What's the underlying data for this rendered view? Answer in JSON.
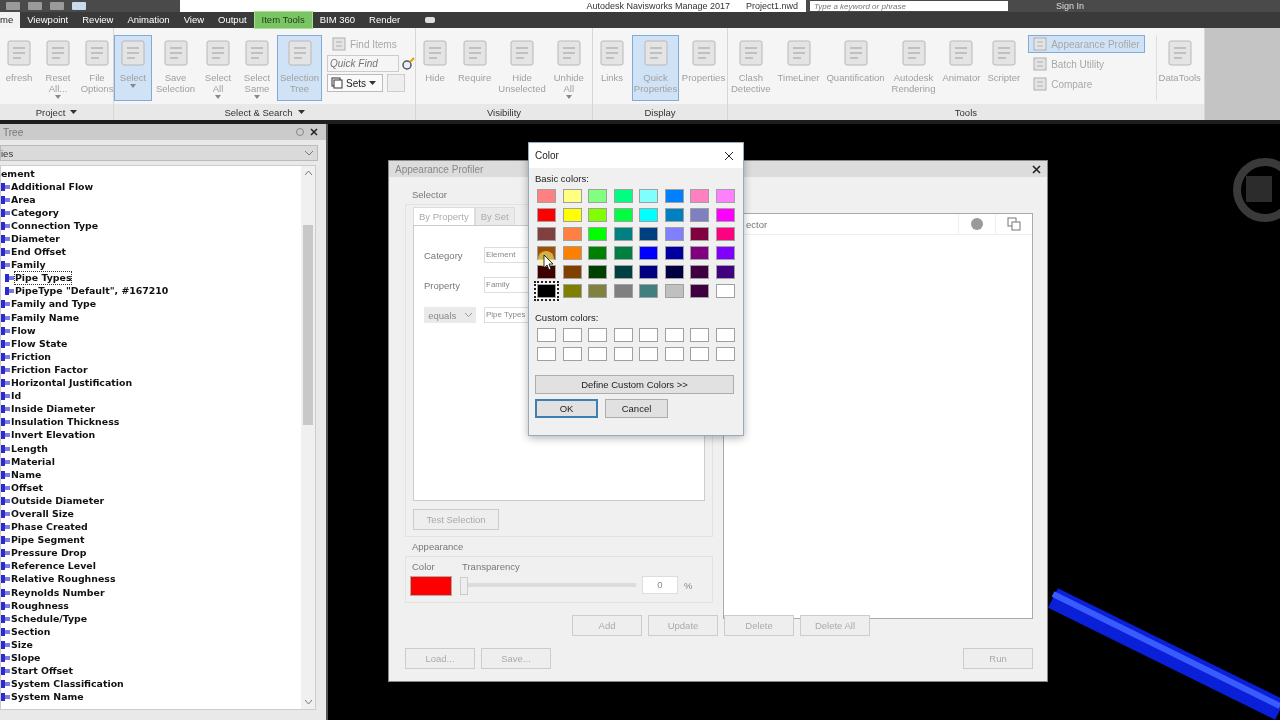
{
  "title_bar": {
    "title": "Autodesk Navisworks Manage 2017",
    "document": "Project1.nwd",
    "search": {
      "placeholder": "Type a keyword or phrase"
    },
    "sign_in": "Sign In"
  },
  "tabs": [
    {
      "label": "me",
      "selected": true,
      "kind": "normal"
    },
    {
      "label": "Viewpoint",
      "selected": false,
      "kind": "normal"
    },
    {
      "label": "Review",
      "selected": false,
      "kind": "normal"
    },
    {
      "label": "Animation",
      "selected": false,
      "kind": "normal"
    },
    {
      "label": "View",
      "selected": false,
      "kind": "normal"
    },
    {
      "label": "Output",
      "selected": false,
      "kind": "normal"
    },
    {
      "label": "Item Tools",
      "selected": false,
      "kind": "contextual"
    },
    {
      "label": "BIM 360",
      "selected": false,
      "kind": "normal"
    },
    {
      "label": "Render",
      "selected": false,
      "kind": "normal"
    }
  ],
  "ribbon": {
    "panels": [
      {
        "label": "Project",
        "menu": true,
        "items": [
          {
            "kind": "large",
            "label": "efresh",
            "active": false,
            "dropdown": false
          },
          {
            "kind": "large",
            "label": "Reset All...",
            "active": false,
            "dropdown": true
          },
          {
            "kind": "large",
            "label": "File Options",
            "active": false,
            "dropdown": false
          }
        ]
      },
      {
        "label": "Select & Search",
        "menu": true,
        "items": [
          {
            "kind": "large",
            "label": "Select",
            "active": true,
            "dropdown": true
          },
          {
            "kind": "large",
            "label": "Save Selection",
            "active": false,
            "dropdown": false
          },
          {
            "kind": "large",
            "label": "Select All",
            "active": false,
            "dropdown": true
          },
          {
            "kind": "large",
            "label": "Select Same",
            "active": false,
            "dropdown": true
          },
          {
            "kind": "large",
            "label": "Selection Tree",
            "active": true,
            "dropdown": false
          },
          {
            "kind": "stack",
            "items": [
              {
                "kind": "small",
                "label": "Find Items",
                "active": false
              },
              {
                "kind": "field",
                "placeholder": "Quick Find"
              },
              {
                "kind": "dropdown",
                "label": "Sets"
              }
            ]
          }
        ]
      },
      {
        "label": "Visibility",
        "menu": false,
        "items": [
          {
            "kind": "large",
            "label": "Hide",
            "active": false,
            "dropdown": false
          },
          {
            "kind": "large",
            "label": "Require",
            "active": false,
            "dropdown": false
          },
          {
            "kind": "large",
            "label": "Hide Unselected",
            "active": false,
            "dropdown": false
          },
          {
            "kind": "large",
            "label": "Unhide All",
            "active": false,
            "dropdown": true
          }
        ]
      },
      {
        "label": "Display",
        "menu": false,
        "items": [
          {
            "kind": "large",
            "label": "Links",
            "active": false,
            "dropdown": false
          },
          {
            "kind": "large",
            "label": "Quick Properties",
            "active": true,
            "dropdown": false
          },
          {
            "kind": "large",
            "label": "Properties",
            "active": false,
            "dropdown": false
          }
        ]
      },
      {
        "label": "Tools",
        "menu": false,
        "items": [
          {
            "kind": "large",
            "label": "Clash Detective",
            "active": false,
            "dropdown": false
          },
          {
            "kind": "large",
            "label": "TimeLiner",
            "active": false,
            "dropdown": false
          },
          {
            "kind": "large",
            "label": "Quantification",
            "active": false,
            "dropdown": false
          },
          {
            "kind": "large",
            "label": "Autodesk Rendering",
            "active": false,
            "dropdown": false
          },
          {
            "kind": "large",
            "label": "Animator",
            "active": false,
            "dropdown": false
          },
          {
            "kind": "large",
            "label": "Scripter",
            "active": false,
            "dropdown": false
          },
          {
            "kind": "stack",
            "items": [
              {
                "kind": "small",
                "label": "Appearance Profiler",
                "active": true
              },
              {
                "kind": "small",
                "label": "Batch Utility",
                "active": false
              },
              {
                "kind": "small",
                "label": "Compare",
                "active": false
              }
            ]
          },
          {
            "kind": "large",
            "label": "DataTools",
            "active": false,
            "dropdown": false
          }
        ]
      }
    ]
  },
  "tree": {
    "header": "Tree",
    "dropdown": "ies",
    "items": [
      {
        "label": "ement",
        "selected": false,
        "children": [
          {
            "label": "Additional Flow",
            "selected": false
          },
          {
            "label": "Area",
            "selected": false
          },
          {
            "label": "Category",
            "selected": false
          },
          {
            "label": "Connection Type",
            "selected": false
          },
          {
            "label": "Diameter",
            "selected": false
          },
          {
            "label": "End Offset",
            "selected": false
          },
          {
            "label": "Family",
            "selected": false,
            "children": [
              {
                "label": "Pipe Types",
                "selected": true
              },
              {
                "label": "PipeType \"Default\", #167210",
                "selected": false
              }
            ]
          },
          {
            "label": "Family and Type",
            "selected": false
          },
          {
            "label": "Family Name",
            "selected": false
          },
          {
            "label": "Flow",
            "selected": false
          },
          {
            "label": "Flow State",
            "selected": false
          },
          {
            "label": "Friction",
            "selected": false
          },
          {
            "label": "Friction Factor",
            "selected": false
          },
          {
            "label": "Horizontal Justification",
            "selected": false
          },
          {
            "label": "Id",
            "selected": false
          },
          {
            "label": "Inside Diameter",
            "selected": false
          },
          {
            "label": "Insulation Thickness",
            "selected": false
          },
          {
            "label": "Invert Elevation",
            "selected": false
          },
          {
            "label": "Length",
            "selected": false
          },
          {
            "label": "Material",
            "selected": false
          },
          {
            "label": "Name",
            "selected": false
          },
          {
            "label": "Offset",
            "selected": false
          },
          {
            "label": "Outside Diameter",
            "selected": false
          },
          {
            "label": "Overall Size",
            "selected": false
          },
          {
            "label": "Phase Created",
            "selected": false
          },
          {
            "label": "Pipe Segment",
            "selected": false
          },
          {
            "label": "Pressure Drop",
            "selected": false
          },
          {
            "label": "Reference Level",
            "selected": false
          },
          {
            "label": "Relative Roughness",
            "selected": false
          },
          {
            "label": "Reynolds Number",
            "selected": false
          },
          {
            "label": "Roughness",
            "selected": false
          },
          {
            "label": "Schedule/Type",
            "selected": false
          },
          {
            "label": "Section",
            "selected": false
          },
          {
            "label": "Size",
            "selected": false
          },
          {
            "label": "Slope",
            "selected": false
          },
          {
            "label": "Start Offset",
            "selected": false
          },
          {
            "label": "System Classification",
            "selected": false
          },
          {
            "label": "System Name",
            "selected": false
          }
        ]
      }
    ]
  },
  "appearance_profiler": {
    "title": "Appearance Profiler",
    "selector": {
      "label": "Selector",
      "tabs": [
        {
          "label": "By Property",
          "selected": true
        },
        {
          "label": "By Set",
          "selected": false
        }
      ],
      "rows": [
        {
          "label": "Category",
          "value": "Element"
        },
        {
          "label": "Property",
          "value": "Family"
        }
      ],
      "condition": "equals",
      "condition_value": "Pipe Types",
      "test_button": "Test Selection"
    },
    "appearance": {
      "label": "Appearance",
      "color_label": "Color",
      "color": "#ff0000",
      "transparency_label": "Transparency",
      "transparency": {
        "level": 0
      },
      "transparency_value": "0",
      "unit": "%"
    },
    "list": {
      "header": "ector"
    },
    "buttons": [
      "Add",
      "Update",
      "Delete",
      "Delete All"
    ],
    "file_buttons": [
      "Load...",
      "Save..."
    ],
    "run_button": "Run"
  },
  "color_dialog": {
    "title": "Color",
    "basic_label": "Basic colors:",
    "basic_colors": [
      {
        "color": "#ff8080",
        "selected": false
      },
      {
        "color": "#ffff80",
        "selected": false
      },
      {
        "color": "#80ff80",
        "selected": false
      },
      {
        "color": "#00ff80",
        "selected": false
      },
      {
        "color": "#80ffff",
        "selected": false
      },
      {
        "color": "#0080ff",
        "selected": false
      },
      {
        "color": "#ff80c0",
        "selected": false
      },
      {
        "color": "#ff80ff",
        "selected": false
      },
      {
        "color": "#ff0000",
        "selected": false
      },
      {
        "color": "#ffff00",
        "selected": false
      },
      {
        "color": "#80ff00",
        "selected": false
      },
      {
        "color": "#00ff40",
        "selected": false
      },
      {
        "color": "#00ffff",
        "selected": false
      },
      {
        "color": "#0080c0",
        "selected": false
      },
      {
        "color": "#8080c0",
        "selected": false
      },
      {
        "color": "#ff00ff",
        "selected": false
      },
      {
        "color": "#804040",
        "selected": false
      },
      {
        "color": "#ff8040",
        "selected": false
      },
      {
        "color": "#00ff00",
        "selected": false
      },
      {
        "color": "#008080",
        "selected": false
      },
      {
        "color": "#004080",
        "selected": false
      },
      {
        "color": "#8080ff",
        "selected": false
      },
      {
        "color": "#800040",
        "selected": false
      },
      {
        "color": "#ff0080",
        "selected": false
      },
      {
        "color": "#a05000",
        "selected": false
      },
      {
        "color": "#ff8000",
        "selected": false
      },
      {
        "color": "#008000",
        "selected": false
      },
      {
        "color": "#008040",
        "selected": false
      },
      {
        "color": "#0000ff",
        "selected": false
      },
      {
        "color": "#0000a0",
        "selected": false
      },
      {
        "color": "#800080",
        "selected": false
      },
      {
        "color": "#8000ff",
        "selected": false
      },
      {
        "color": "#400000",
        "selected": false
      },
      {
        "color": "#804000",
        "selected": false
      },
      {
        "color": "#004000",
        "selected": false
      },
      {
        "color": "#004040",
        "selected": false
      },
      {
        "color": "#000080",
        "selected": false
      },
      {
        "color": "#000040",
        "selected": false
      },
      {
        "color": "#400040",
        "selected": false
      },
      {
        "color": "#400080",
        "selected": false
      },
      {
        "color": "#000000",
        "selected": true
      },
      {
        "color": "#808000",
        "selected": false
      },
      {
        "color": "#808040",
        "selected": false
      },
      {
        "color": "#808080",
        "selected": false
      },
      {
        "color": "#408080",
        "selected": false
      },
      {
        "color": "#c0c0c0",
        "selected": false
      },
      {
        "color": "#400040",
        "selected": false
      },
      {
        "color": "#ffffff",
        "selected": false
      }
    ],
    "custom_label": "Custom colors:",
    "custom_colors": [
      {
        "color": "#ffffff"
      },
      {
        "color": "#ffffff"
      },
      {
        "color": "#ffffff"
      },
      {
        "color": "#ffffff"
      },
      {
        "color": "#ffffff"
      },
      {
        "color": "#ffffff"
      },
      {
        "color": "#ffffff"
      },
      {
        "color": "#ffffff"
      },
      {
        "color": "#ffffff"
      },
      {
        "color": "#ffffff"
      },
      {
        "color": "#ffffff"
      },
      {
        "color": "#ffffff"
      },
      {
        "color": "#ffffff"
      },
      {
        "color": "#ffffff"
      },
      {
        "color": "#ffffff"
      },
      {
        "color": "#ffffff"
      }
    ],
    "define_button": "Define Custom Colors >>",
    "ok_button": "OK",
    "cancel_button": "Cancel"
  }
}
